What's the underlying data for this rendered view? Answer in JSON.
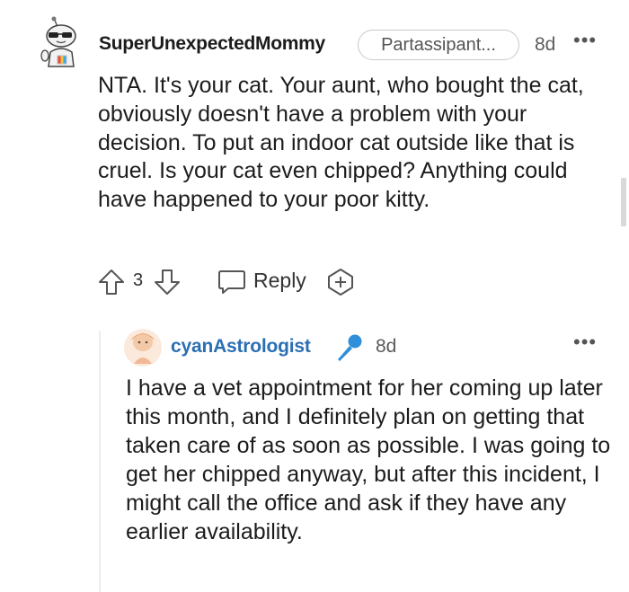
{
  "comment": {
    "username": "SuperUnexpectedMommy",
    "flair": "Partassipant...",
    "time": "8d",
    "more": "•••",
    "body": "NTA. It's your cat. Your aunt, who bought the cat, obviously doesn't have a problem with your decision. To put an indoor cat outside like that is cruel. Is your cat even chipped? Anything could have happened to your poor kitty.",
    "vote_count": "3",
    "reply_label": "Reply"
  },
  "reply": {
    "username": "cyanAstrologist",
    "time": "8d",
    "more": "•••",
    "body": "I have a vet appointment for her coming up later this month, and I definitely plan on getting that taken care of as soon as possible. I was going to get her chipped anyway, but after this incident, I might call the office and ask if they have any earlier availability."
  },
  "icons": [
    "snoo-avatar-icon",
    "upvote-icon",
    "downvote-icon",
    "comment-bubble-icon",
    "award-plus-icon",
    "user-avatar-icon",
    "microphone-icon"
  ],
  "colors": {
    "username_reply": "#2b6fb3",
    "mic": "#2f8fd8",
    "text": "#1c1c1c"
  }
}
